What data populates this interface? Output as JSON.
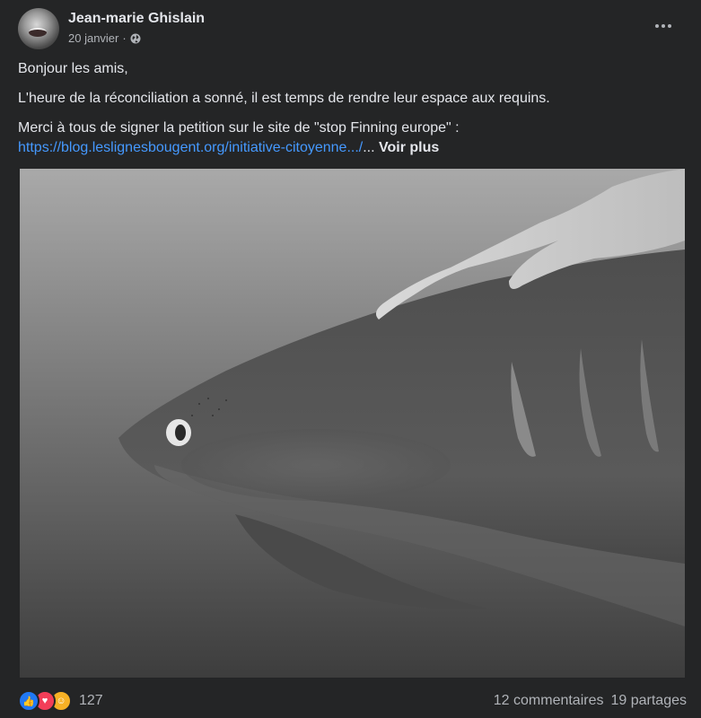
{
  "post": {
    "author": "Jean-marie Ghislain",
    "date": "20 janvier",
    "separator": "·",
    "paragraphs": [
      "Bonjour les amis,",
      "L'heure de la réconciliation a sonné, il est temps de rendre leur espace aux requins.",
      "Merci à tous de signer la petition sur le site de \"stop Finning europe\" :"
    ],
    "link_text": "https://blog.leslignesbougent.org/initiative-citoyenne.../",
    "ellipsis": "...",
    "see_more": "Voir plus"
  },
  "footer": {
    "reaction_icons": [
      "like-icon",
      "love-icon",
      "care-icon"
    ],
    "reaction_count": "127",
    "comments": "12 commentaires",
    "shares": "19 partages"
  },
  "colors": {
    "background": "#242526",
    "text": "#e4e6eb",
    "secondary": "#b0b3b8",
    "link": "#4599ff"
  }
}
